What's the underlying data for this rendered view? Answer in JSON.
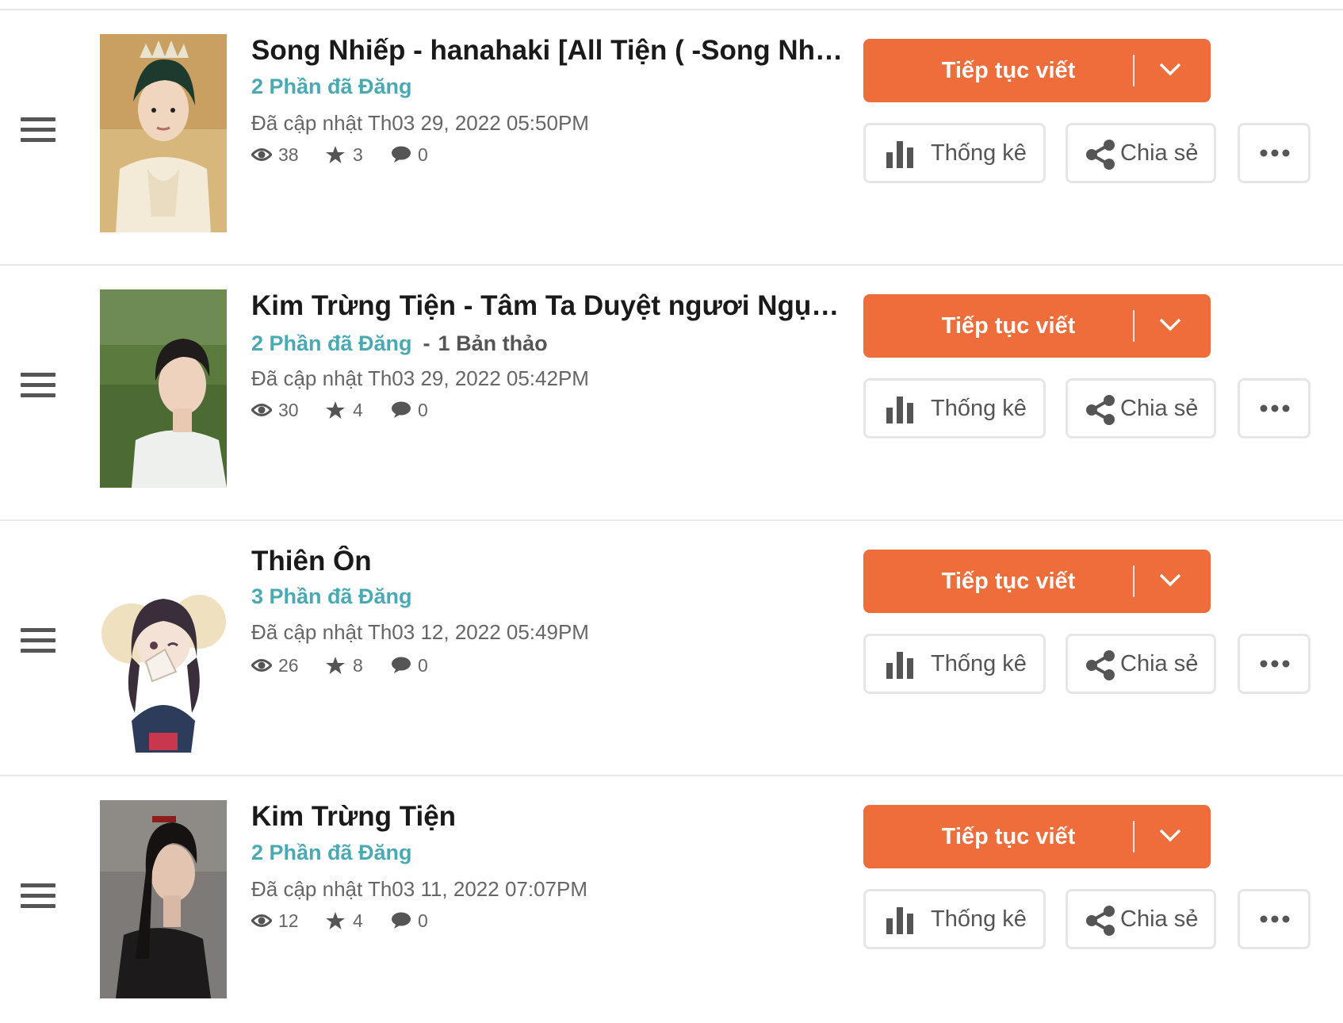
{
  "stories": [
    {
      "title": "Song Nhiếp - hanahaki [All Tiện ( -Song Nhiếp )]",
      "published_parts": "2 Phần đã Đăng",
      "drafts": "",
      "updated": "Đã cập nhật Th03 29, 2022 05:50PM",
      "views": "38",
      "votes": "3",
      "comments": "0"
    },
    {
      "title": "Kim Trừng Tiện - Tâm Ta Duyệt ngươi Ngụy Vô Tiện",
      "published_parts": "2 Phần đã Đăng",
      "drafts": "1 Bản thảo",
      "updated": "Đã cập nhật Th03 29, 2022 05:42PM",
      "views": "30",
      "votes": "4",
      "comments": "0"
    },
    {
      "title": "Thiên Ôn",
      "published_parts": "3 Phần đã Đăng",
      "drafts": "",
      "updated": "Đã cập nhật Th03 12, 2022 05:49PM",
      "views": "26",
      "votes": "8",
      "comments": "0"
    },
    {
      "title": "Kim Trừng Tiện",
      "published_parts": "2 Phần đã Đăng",
      "drafts": "",
      "updated": "Đã cập nhật Th03 11, 2022 07:07PM",
      "views": "12",
      "votes": "4",
      "comments": "0"
    }
  ],
  "labels": {
    "continue_writing": "Tiếp tục viết",
    "stats": "Thống kê",
    "share": "Chia sẻ",
    "draft_separator": "-"
  },
  "colors": {
    "accent": "#ee6d3b",
    "published": "#4aa9b3",
    "text": "#1a1a1a",
    "muted": "#666666",
    "border": "#e6e6e6"
  },
  "icons": {
    "drag": "hamburger-icon",
    "views": "eye-icon",
    "votes": "star-icon",
    "comments": "comment-icon",
    "stats": "bar-chart-icon",
    "share": "share-icon",
    "more": "ellipsis-icon",
    "dropdown": "chevron-down-icon"
  }
}
